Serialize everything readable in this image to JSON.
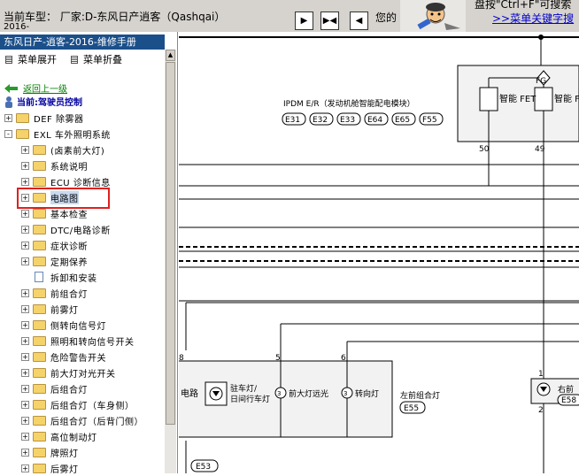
{
  "header": {
    "vehicle_label": "当前车型：  厂家:D-东风日产逍客（Qashqai）",
    "vehicle_sub": "2016-",
    "nav_text": "您的",
    "search_hint": "盘按\"Ctrl+F\"可搜索",
    "search_link": ">>菜单关键字搜",
    "nav_buttons": [
      "▶",
      "▶◀",
      "◀"
    ]
  },
  "sidebar": {
    "title": "东风日产-逍客-2016-维修手册",
    "expand_label": "菜单展开",
    "collapse_label": "菜单折叠",
    "back_label": "返回上一级",
    "current_label": "当前:驾驶员控制",
    "tree": [
      {
        "label": "DEF 除雾器",
        "level": 0,
        "toggle": "+",
        "type": "folder"
      },
      {
        "label": "EXL 车外照明系统",
        "level": 0,
        "toggle": "-",
        "type": "folder"
      },
      {
        "label": "(卤素前大灯)",
        "level": 1,
        "toggle": "+",
        "type": "folder"
      },
      {
        "label": "系统说明",
        "level": 1,
        "toggle": "+",
        "type": "folder"
      },
      {
        "label": "ECU 诊断信息",
        "level": 1,
        "toggle": "+",
        "type": "folder"
      },
      {
        "label": "电路图",
        "level": 1,
        "toggle": "+",
        "type": "folder",
        "selected": true
      },
      {
        "label": "基本检查",
        "level": 1,
        "toggle": "+",
        "type": "folder"
      },
      {
        "label": "DTC/电路诊断",
        "level": 1,
        "toggle": "+",
        "type": "folder"
      },
      {
        "label": "症状诊断",
        "level": 1,
        "toggle": "+",
        "type": "folder"
      },
      {
        "label": "定期保养",
        "level": 1,
        "toggle": "+",
        "type": "folder"
      },
      {
        "label": "拆卸和安装",
        "level": 1,
        "toggle": "",
        "type": "doc"
      },
      {
        "label": "前组合灯",
        "level": 1,
        "toggle": "+",
        "type": "folder"
      },
      {
        "label": "前雾灯",
        "level": 1,
        "toggle": "+",
        "type": "folder"
      },
      {
        "label": "侧转向信号灯",
        "level": 1,
        "toggle": "+",
        "type": "folder"
      },
      {
        "label": "照明和转向信号开关",
        "level": 1,
        "toggle": "+",
        "type": "folder"
      },
      {
        "label": "危险警告开关",
        "level": 1,
        "toggle": "+",
        "type": "folder"
      },
      {
        "label": "前大灯对光开关",
        "level": 1,
        "toggle": "+",
        "type": "folder"
      },
      {
        "label": "后组合灯",
        "level": 1,
        "toggle": "+",
        "type": "folder"
      },
      {
        "label": "后组合灯（车身侧）",
        "level": 1,
        "toggle": "+",
        "type": "folder"
      },
      {
        "label": "后组合灯（后背门侧）",
        "level": 1,
        "toggle": "+",
        "type": "folder"
      },
      {
        "label": "高位制动灯",
        "level": 1,
        "toggle": "+",
        "type": "folder"
      },
      {
        "label": "牌照灯",
        "level": 1,
        "toggle": "+",
        "type": "folder"
      },
      {
        "label": "后雾灯",
        "level": 1,
        "toggle": "+",
        "type": "folder"
      }
    ]
  },
  "diagram": {
    "ipdm_title": "IPDM E/R（发动机舱智能配电模块）",
    "connectors": [
      "E31",
      "E32",
      "E33",
      "E64",
      "E65",
      "F55"
    ],
    "fg_label": "FG",
    "fet_label_1": "智能 FET",
    "fet_label_2": "智能 F",
    "pin_50": "50",
    "pin_49": "49",
    "pin_8": "8",
    "pin_5": "5",
    "pin_6": "6",
    "pin_1": "1",
    "pin_2": "2",
    "circuit_label": "电路",
    "lamp_parking": "驻车灯/",
    "lamp_drl": "日间行车灯",
    "lamp_high": "前大灯远光",
    "lamp_turn": "转向灯",
    "front_combo": "左前组合灯",
    "conn_e55": "E55",
    "right_front": "右前",
    "conn_e58": "E58",
    "conn_e53": "E53"
  },
  "colors": {
    "title_bg": "#1b4f8a",
    "highlight": "#e02020",
    "toolbar_bg": "#d6d3ce",
    "link": "#0000cc",
    "back_link": "#008000"
  }
}
